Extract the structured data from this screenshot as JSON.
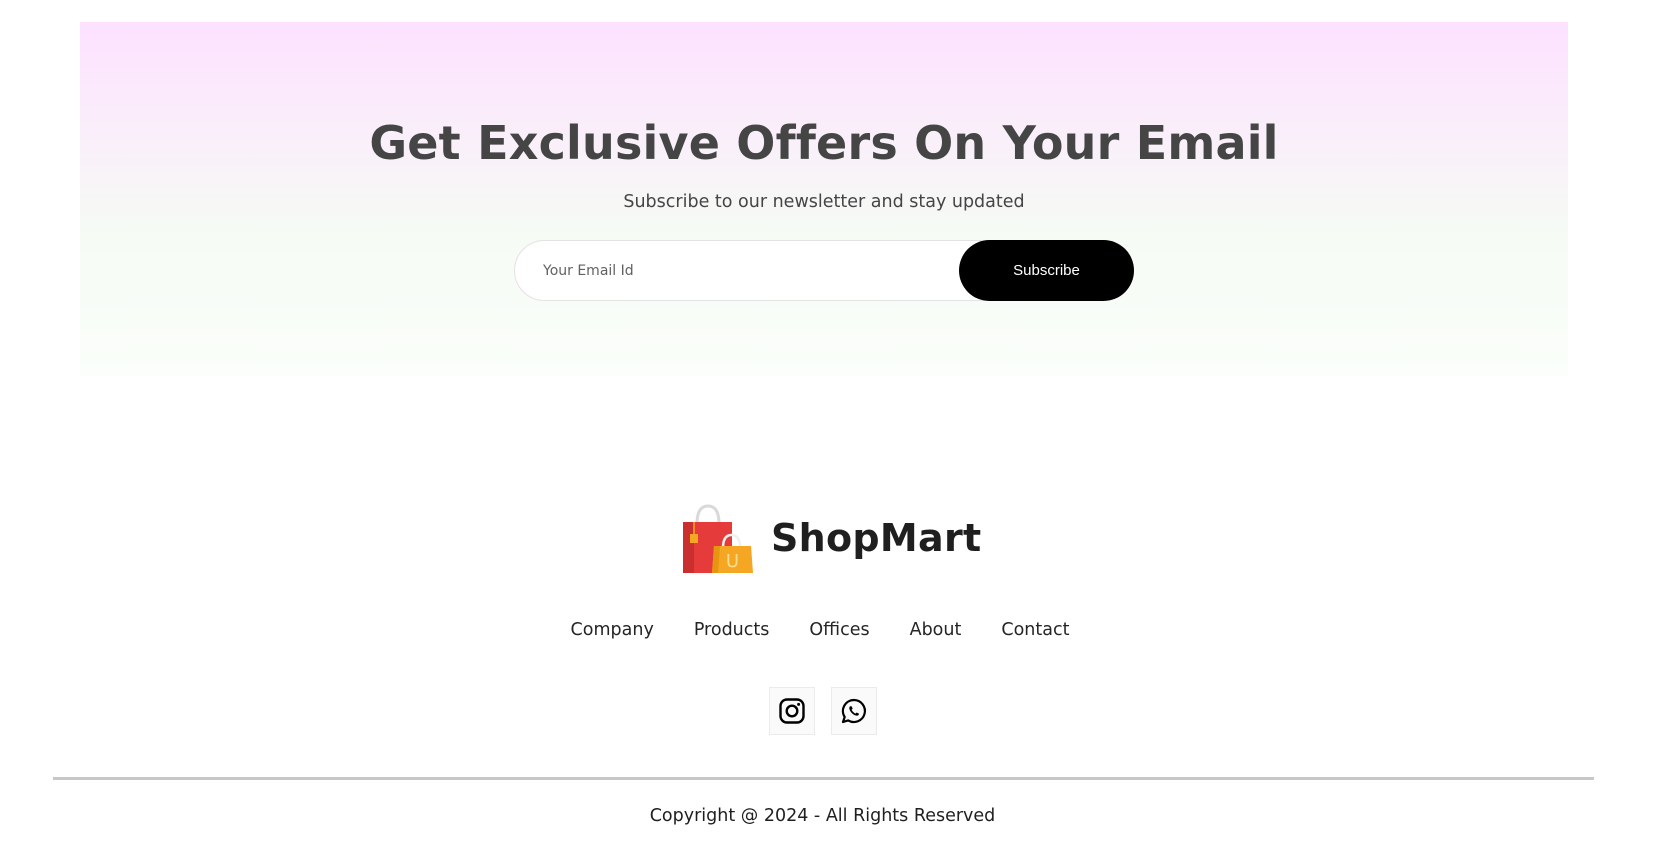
{
  "newsletter": {
    "title": "Get Exclusive Offers On Your Email",
    "subtitle": "Subscribe to our newsletter and stay updated",
    "email_placeholder": "Your Email Id",
    "email_value": "",
    "subscribe_label": "Subscribe"
  },
  "footer": {
    "brand": {
      "name": "ShopMart",
      "logo_icon": "shopping-bags-icon",
      "logo_letter": "U"
    },
    "links": [
      {
        "label": "Company"
      },
      {
        "label": "Products"
      },
      {
        "label": "Offices"
      },
      {
        "label": "About"
      },
      {
        "label": "Contact"
      }
    ],
    "social": [
      {
        "icon": "instagram-icon"
      },
      {
        "icon": "whatsapp-icon"
      }
    ],
    "copyright": "Copyright @ 2024 - All Rights Reserved"
  },
  "colors": {
    "gradient_top": "#fde1ff",
    "gradient_bottom": "#f6fbf5",
    "button_bg": "#000000",
    "button_text": "#ffffff",
    "bag_red": "#e63b3b",
    "bag_orange": "#f5a623",
    "divider": "#c7c7c7"
  }
}
